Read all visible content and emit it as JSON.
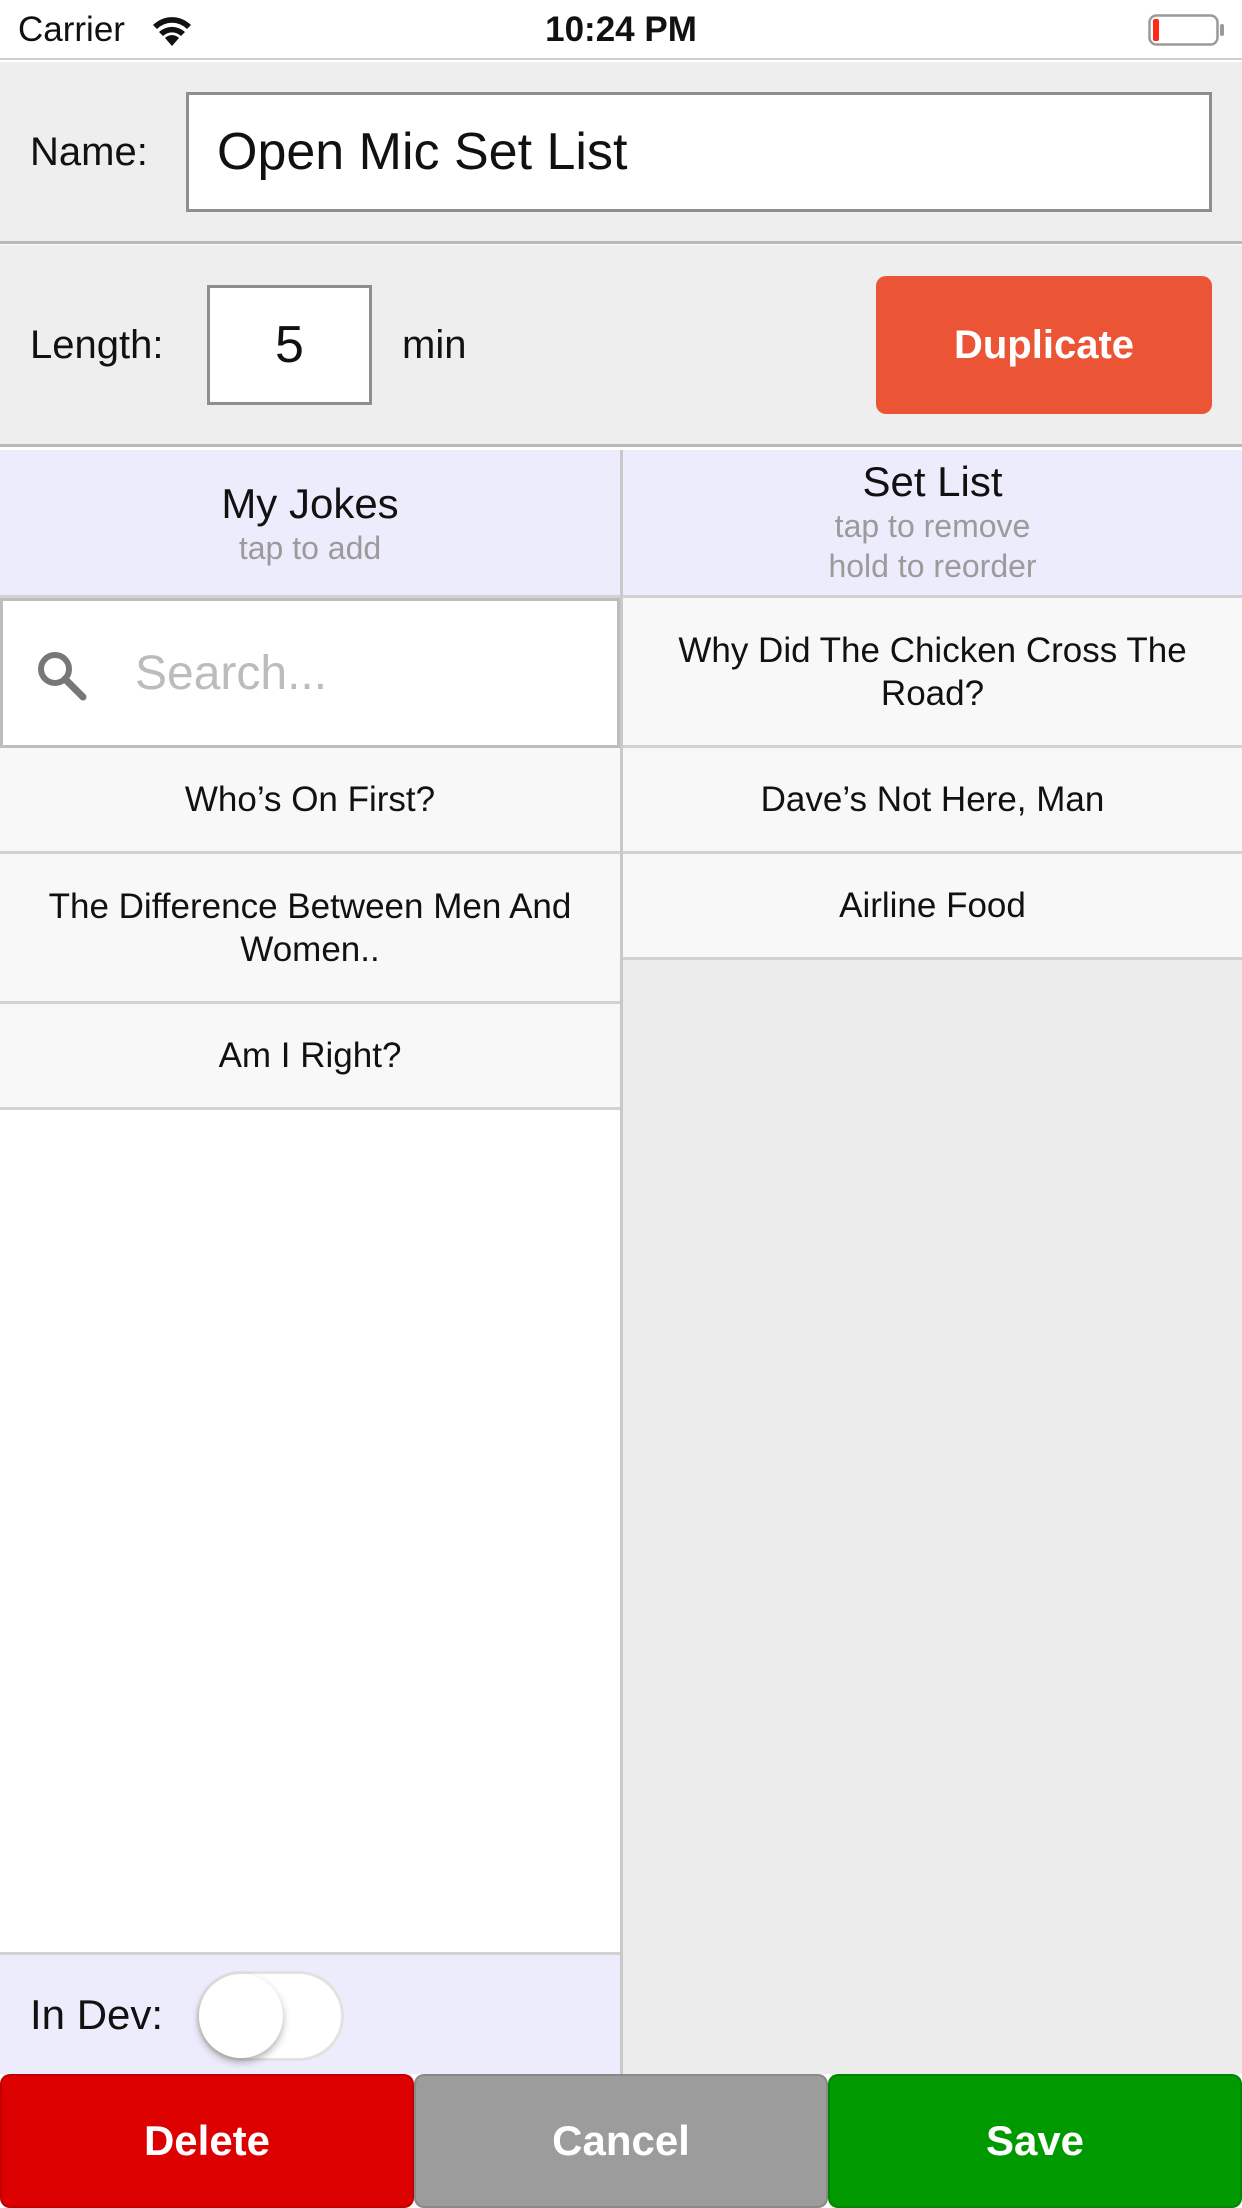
{
  "status_bar": {
    "carrier": "Carrier",
    "time": "10:24 PM",
    "icons": [
      "wifi-icon",
      "battery-low-icon"
    ]
  },
  "name_field": {
    "label": "Name:",
    "value": "Open Mic Set List"
  },
  "length_field": {
    "label": "Length:",
    "value": "5",
    "unit": "min"
  },
  "duplicate_label": "Duplicate",
  "my_jokes": {
    "title": "My Jokes",
    "subtitle": "tap to add",
    "search_placeholder": "Search...",
    "items": [
      "Who’s On First?",
      "The Difference Between Men And Women..",
      "Am I Right?"
    ]
  },
  "set_list": {
    "title": "Set List",
    "subtitle_1": "tap to remove",
    "subtitle_2": "hold to reorder",
    "items": [
      "Why Did The Chicken Cross The Road?",
      "Dave’s Not Here, Man",
      "Airline Food"
    ]
  },
  "in_dev": {
    "label": "In Dev:",
    "enabled": false
  },
  "buttons": {
    "delete": "Delete",
    "cancel": "Cancel",
    "save": "Save"
  },
  "colors": {
    "duplicate": "#eb5434",
    "delete": "#dd0000",
    "cancel": "#9c9c9c",
    "save": "#009900",
    "header_bg": "#ececfc"
  }
}
